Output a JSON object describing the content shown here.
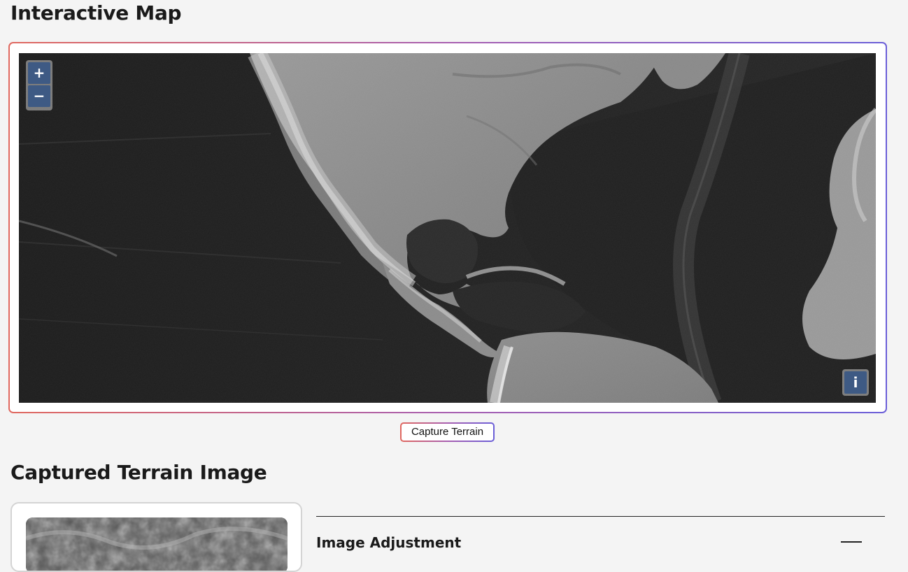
{
  "page": {
    "title": "Interactive Map"
  },
  "map": {
    "zoom_in_label": "+",
    "zoom_out_label": "−",
    "info_label": "i",
    "terrain_style": "grayscale hillshade"
  },
  "capture": {
    "button_label": "Capture Terrain"
  },
  "captured_section": {
    "title": "Captured Terrain Image"
  },
  "adjustment": {
    "title": "Image Adjustment",
    "state": "expanded"
  },
  "colors": {
    "accent_gradient_start": "#e0685f",
    "accent_gradient_end": "#6b5fd8",
    "control_button": "#3e5a84",
    "page_background": "#f4f4f4"
  },
  "icons": {
    "zoom_in": "plus-icon",
    "zoom_out": "minus-icon",
    "info": "info-icon",
    "collapse": "minus-line-icon"
  }
}
